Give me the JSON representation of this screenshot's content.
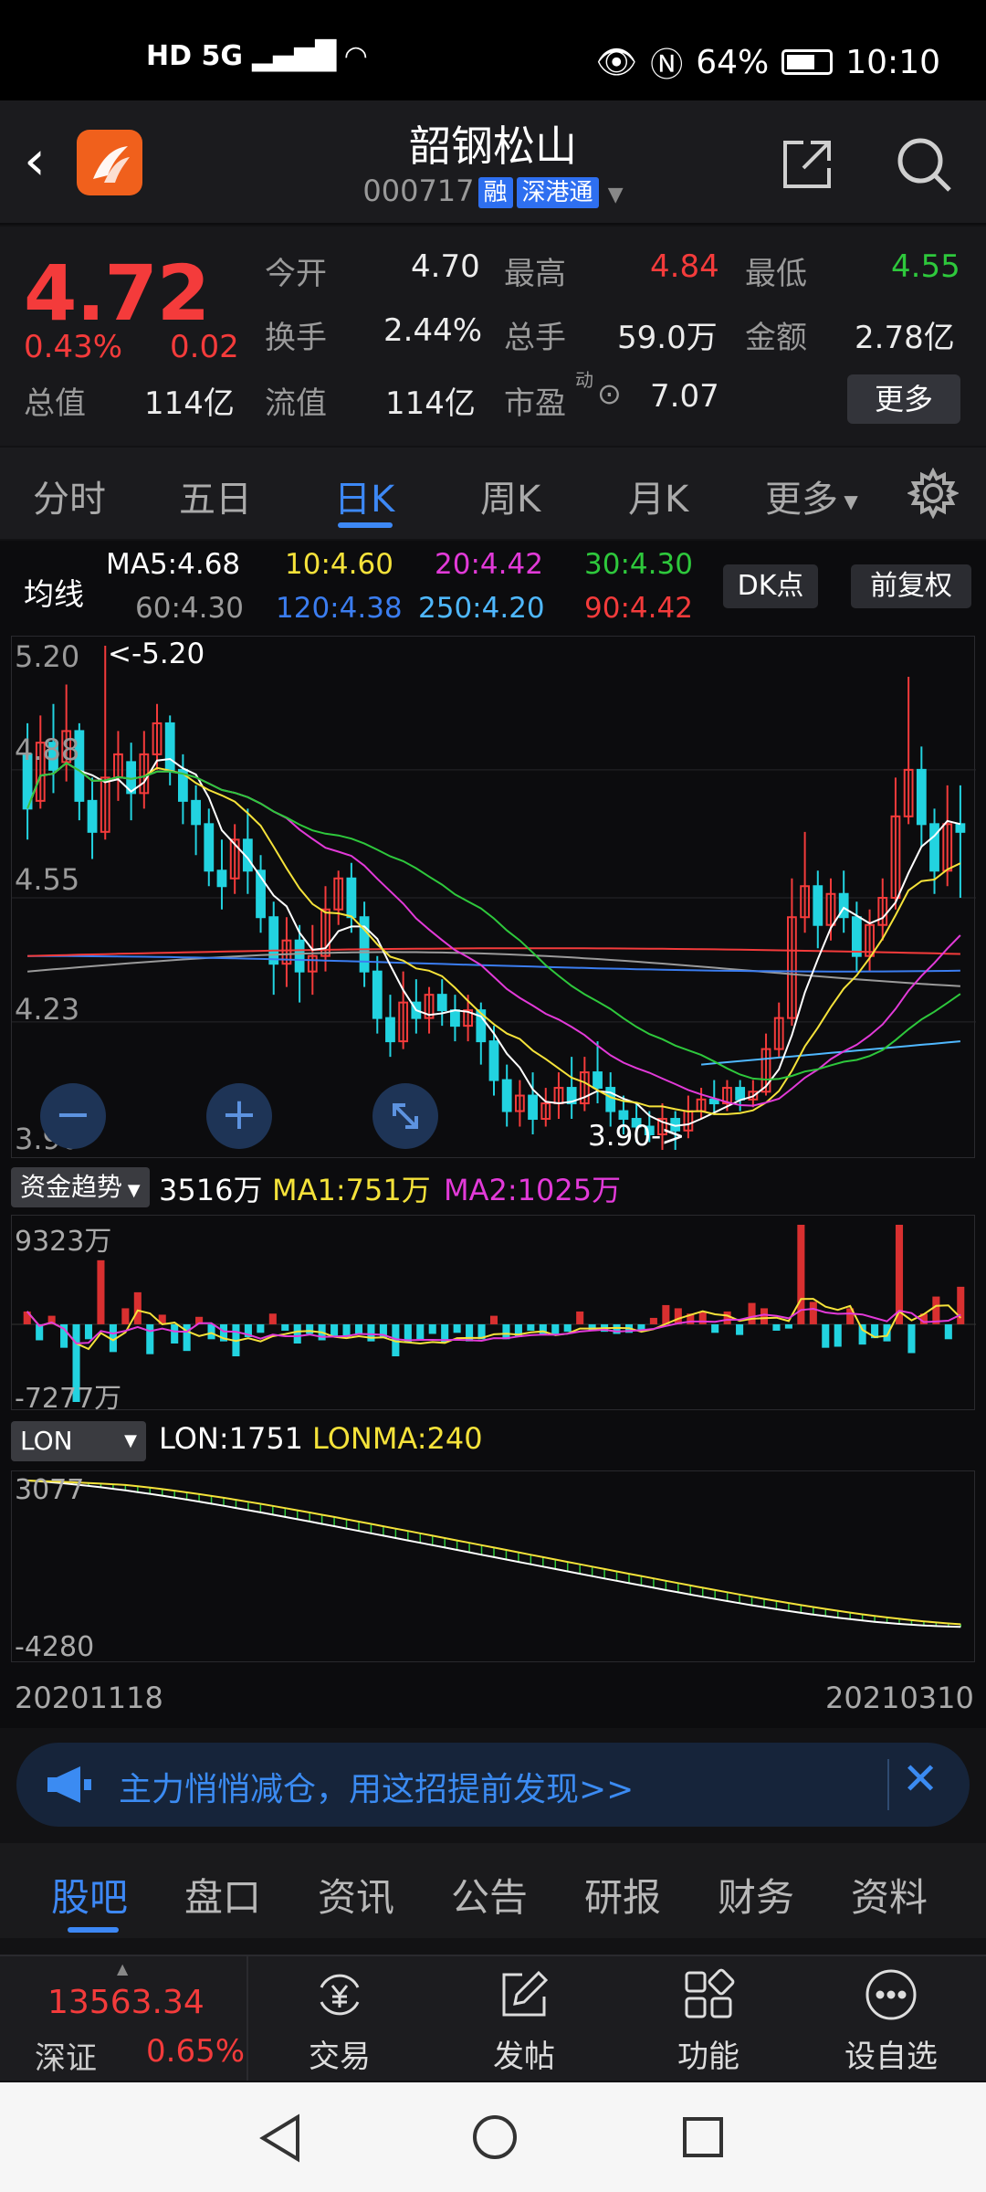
{
  "status_bar": {
    "network_left": "HD 5G",
    "battery": "64%",
    "time": "10:10"
  },
  "header": {
    "title": "韶钢松山",
    "code": "000717",
    "tags": [
      "融",
      "深港通"
    ]
  },
  "quote": {
    "price": "4.72",
    "change_pct": "0.43%",
    "change": "0.02",
    "fields": [
      {
        "label": "今开",
        "value": "4.70"
      },
      {
        "label": "最高",
        "value": "4.84"
      },
      {
        "label": "最低",
        "value": "4.55"
      },
      {
        "label": "换手",
        "value": "2.44%"
      },
      {
        "label": "总手",
        "value": "59.0万"
      },
      {
        "label": "金额",
        "value": "2.78亿"
      },
      {
        "label": "总值",
        "value": "114亿"
      },
      {
        "label": "流值",
        "value": "114亿"
      },
      {
        "label": "市盈",
        "value": "7.07"
      }
    ],
    "pe_sup": "动",
    "more_label": "更多"
  },
  "period_tabs": [
    "分时",
    "五日",
    "日K",
    "周K",
    "月K",
    "更多"
  ],
  "active_period": "日K",
  "ma_legend": {
    "label": "均线",
    "row1": [
      {
        "text": "MA5:4.68",
        "color": "#ffffff"
      },
      {
        "text": "10:4.60",
        "color": "#f5e23a"
      },
      {
        "text": "20:4.42",
        "color": "#e23ad8"
      },
      {
        "text": "30:4.30",
        "color": "#2ec83c"
      }
    ],
    "row2": [
      {
        "text": "60:4.30",
        "color": "#9a9a9a"
      },
      {
        "text": "120:4.38",
        "color": "#3b7df0"
      },
      {
        "text": "250:4.20",
        "color": "#4fb8ff"
      },
      {
        "text": "90:4.42",
        "color": "#f43b3b"
      }
    ],
    "dk_label": "DK点",
    "adjust_label": "前复权"
  },
  "chart_data": [
    {
      "type": "candlestick",
      "y_ticks": [
        "5.20",
        "4.88",
        "4.55",
        "4.23",
        "3.90"
      ],
      "ylim": [
        3.9,
        5.2
      ],
      "high_marker": "<-5.20",
      "low_marker": "3.90->",
      "candles": [
        {
          "o": 4.92,
          "c": 4.78,
          "h": 5.0,
          "l": 4.7
        },
        {
          "o": 4.8,
          "c": 4.95,
          "h": 5.02,
          "l": 4.78
        },
        {
          "o": 4.95,
          "c": 4.88,
          "h": 5.05,
          "l": 4.82
        },
        {
          "o": 4.9,
          "c": 4.98,
          "h": 5.1,
          "l": 4.85
        },
        {
          "o": 4.98,
          "c": 4.8,
          "h": 5.0,
          "l": 4.75
        },
        {
          "o": 4.8,
          "c": 4.72,
          "h": 4.86,
          "l": 4.65
        },
        {
          "o": 4.72,
          "c": 4.86,
          "h": 5.2,
          "l": 4.7
        },
        {
          "o": 4.86,
          "c": 4.92,
          "h": 4.98,
          "l": 4.8
        },
        {
          "o": 4.9,
          "c": 4.82,
          "h": 4.95,
          "l": 4.75
        },
        {
          "o": 4.82,
          "c": 4.92,
          "h": 4.98,
          "l": 4.78
        },
        {
          "o": 4.92,
          "c": 5.0,
          "h": 5.05,
          "l": 4.88
        },
        {
          "o": 5.0,
          "c": 4.88,
          "h": 5.02,
          "l": 4.84
        },
        {
          "o": 4.88,
          "c": 4.8,
          "h": 4.92,
          "l": 4.74
        },
        {
          "o": 4.8,
          "c": 4.74,
          "h": 4.84,
          "l": 4.66
        },
        {
          "o": 4.74,
          "c": 4.62,
          "h": 4.78,
          "l": 4.58
        },
        {
          "o": 4.62,
          "c": 4.58,
          "h": 4.7,
          "l": 4.52
        },
        {
          "o": 4.6,
          "c": 4.7,
          "h": 4.74,
          "l": 4.56
        },
        {
          "o": 4.7,
          "c": 4.62,
          "h": 4.78,
          "l": 4.56
        },
        {
          "o": 4.62,
          "c": 4.5,
          "h": 4.66,
          "l": 4.46
        },
        {
          "o": 4.5,
          "c": 4.38,
          "h": 4.54,
          "l": 4.3
        },
        {
          "o": 4.38,
          "c": 4.44,
          "h": 4.5,
          "l": 4.32
        },
        {
          "o": 4.44,
          "c": 4.36,
          "h": 4.48,
          "l": 4.28
        },
        {
          "o": 4.36,
          "c": 4.4,
          "h": 4.48,
          "l": 4.3
        },
        {
          "o": 4.4,
          "c": 4.52,
          "h": 4.58,
          "l": 4.36
        },
        {
          "o": 4.52,
          "c": 4.6,
          "h": 4.62,
          "l": 4.48
        },
        {
          "o": 4.6,
          "c": 4.5,
          "h": 4.64,
          "l": 4.46
        },
        {
          "o": 4.5,
          "c": 4.36,
          "h": 4.54,
          "l": 4.32
        },
        {
          "o": 4.36,
          "c": 4.24,
          "h": 4.4,
          "l": 4.2
        },
        {
          "o": 4.24,
          "c": 4.18,
          "h": 4.3,
          "l": 4.14
        },
        {
          "o": 4.18,
          "c": 4.28,
          "h": 4.36,
          "l": 4.16
        },
        {
          "o": 4.28,
          "c": 4.24,
          "h": 4.34,
          "l": 4.2
        },
        {
          "o": 4.24,
          "c": 4.3,
          "h": 4.32,
          "l": 4.2
        },
        {
          "o": 4.3,
          "c": 4.26,
          "h": 4.34,
          "l": 4.22
        },
        {
          "o": 4.26,
          "c": 4.22,
          "h": 4.3,
          "l": 4.18
        },
        {
          "o": 4.22,
          "c": 4.26,
          "h": 4.3,
          "l": 4.18
        },
        {
          "o": 4.26,
          "c": 4.18,
          "h": 4.28,
          "l": 4.12
        },
        {
          "o": 4.18,
          "c": 4.08,
          "h": 4.22,
          "l": 4.04
        },
        {
          "o": 4.08,
          "c": 4.0,
          "h": 4.12,
          "l": 3.96
        },
        {
          "o": 4.0,
          "c": 4.04,
          "h": 4.08,
          "l": 3.96
        },
        {
          "o": 4.04,
          "c": 3.98,
          "h": 4.1,
          "l": 3.94
        },
        {
          "o": 3.98,
          "c": 4.02,
          "h": 4.06,
          "l": 3.96
        },
        {
          "o": 4.02,
          "c": 4.06,
          "h": 4.1,
          "l": 3.98
        },
        {
          "o": 4.06,
          "c": 4.02,
          "h": 4.14,
          "l": 3.98
        },
        {
          "o": 4.02,
          "c": 4.1,
          "h": 4.14,
          "l": 4.0
        },
        {
          "o": 4.1,
          "c": 4.06,
          "h": 4.18,
          "l": 4.02
        },
        {
          "o": 4.06,
          "c": 4.0,
          "h": 4.1,
          "l": 3.96
        },
        {
          "o": 4.0,
          "c": 3.98,
          "h": 4.04,
          "l": 3.94
        },
        {
          "o": 3.98,
          "c": 3.96,
          "h": 4.02,
          "l": 3.92
        },
        {
          "o": 3.96,
          "c": 3.94,
          "h": 4.0,
          "l": 3.92
        },
        {
          "o": 3.94,
          "c": 3.98,
          "h": 4.02,
          "l": 3.9
        },
        {
          "o": 3.98,
          "c": 3.95,
          "h": 4.0,
          "l": 3.9
        },
        {
          "o": 3.95,
          "c": 4.0,
          "h": 4.04,
          "l": 3.93
        },
        {
          "o": 4.0,
          "c": 4.03,
          "h": 4.06,
          "l": 3.98
        },
        {
          "o": 4.03,
          "c": 4.02,
          "h": 4.08,
          "l": 3.99
        },
        {
          "o": 4.02,
          "c": 4.06,
          "h": 4.08,
          "l": 4.0
        },
        {
          "o": 4.06,
          "c": 4.03,
          "h": 4.08,
          "l": 4.0
        },
        {
          "o": 4.03,
          "c": 4.05,
          "h": 4.08,
          "l": 4.01
        },
        {
          "o": 4.05,
          "c": 4.16,
          "h": 4.2,
          "l": 4.04
        },
        {
          "o": 4.16,
          "c": 4.24,
          "h": 4.28,
          "l": 4.14
        },
        {
          "o": 4.24,
          "c": 4.5,
          "h": 4.6,
          "l": 4.22
        },
        {
          "o": 4.5,
          "c": 4.58,
          "h": 4.72,
          "l": 4.46
        },
        {
          "o": 4.58,
          "c": 4.48,
          "h": 4.62,
          "l": 4.42
        },
        {
          "o": 4.48,
          "c": 4.56,
          "h": 4.6,
          "l": 4.44
        },
        {
          "o": 4.56,
          "c": 4.5,
          "h": 4.62,
          "l": 4.46
        },
        {
          "o": 4.5,
          "c": 4.4,
          "h": 4.54,
          "l": 4.36
        },
        {
          "o": 4.4,
          "c": 4.48,
          "h": 4.52,
          "l": 4.36
        },
        {
          "o": 4.48,
          "c": 4.55,
          "h": 4.6,
          "l": 4.44
        },
        {
          "o": 4.55,
          "c": 4.76,
          "h": 4.86,
          "l": 4.52
        },
        {
          "o": 4.76,
          "c": 4.88,
          "h": 5.12,
          "l": 4.74
        },
        {
          "o": 4.88,
          "c": 4.74,
          "h": 4.94,
          "l": 4.68
        },
        {
          "o": 4.74,
          "c": 4.62,
          "h": 4.78,
          "l": 4.56
        },
        {
          "o": 4.62,
          "c": 4.74,
          "h": 4.84,
          "l": 4.58
        },
        {
          "o": 4.74,
          "c": 4.72,
          "h": 4.84,
          "l": 4.55
        }
      ]
    },
    {
      "type": "bar",
      "name": "资金趋势",
      "value_label": "3516万",
      "ma1_label": "MA1:751万",
      "ma2_label": "MA2:1025万",
      "top_label": "9323万",
      "bottom_label": "-7277万",
      "values": [
        1200,
        -1500,
        800,
        -2200,
        -7277,
        -1400,
        6000,
        -2600,
        1500,
        3000,
        -2800,
        900,
        -1800,
        -2500,
        700,
        -1400,
        -1600,
        -3000,
        -1200,
        -800,
        1000,
        -600,
        -1800,
        -900,
        -1500,
        -1100,
        -1200,
        -900,
        -1600,
        -1300,
        -3000,
        -1700,
        -1400,
        -900,
        -1700,
        -800,
        -1600,
        -1400,
        800,
        -1400,
        -1200,
        -600,
        -900,
        -1000,
        -700,
        1200,
        -600,
        -700,
        -900,
        -800,
        -500,
        600,
        1800,
        1500,
        1000,
        1200,
        -800,
        1200,
        -1000,
        2000,
        1500,
        -600,
        -400,
        9323,
        2100,
        -2200,
        -2100,
        1500,
        -1900,
        -1300,
        -1600,
        9323,
        -2700,
        1000,
        2600,
        -1400,
        3516
      ]
    },
    {
      "type": "histogram",
      "name": "LON",
      "lon_label": "LON:1751",
      "lonma_label": "LONMA:240",
      "top_label": "3077",
      "bottom_label": "-4280",
      "x_start": "20201118",
      "x_end": "20210310"
    }
  ],
  "banner": {
    "text": "主力悄悄减仓，用这招提前发现>>"
  },
  "bottom_tabs": [
    "股吧",
    "盘口",
    "资讯",
    "公告",
    "研报",
    "财务",
    "资料"
  ],
  "active_bottom_tab": "股吧",
  "index": {
    "value": "13563.34",
    "name": "深证",
    "change": "0.65%"
  },
  "tools": [
    "交易",
    "发帖",
    "功能",
    "设自选"
  ]
}
